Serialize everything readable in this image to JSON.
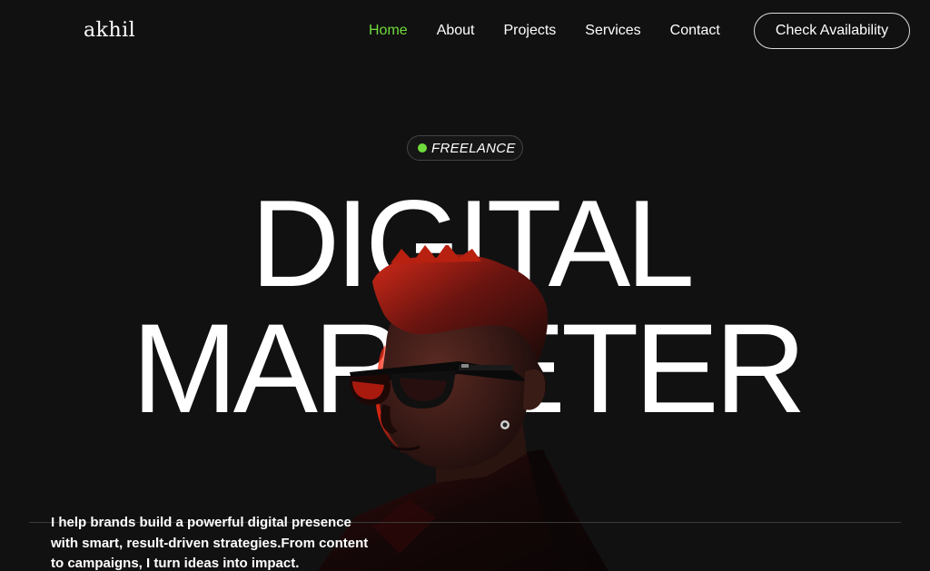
{
  "header": {
    "logo": "akhil",
    "nav": [
      {
        "label": "Home",
        "active": true
      },
      {
        "label": "About",
        "active": false
      },
      {
        "label": "Projects",
        "active": false
      },
      {
        "label": "Services",
        "active": false
      },
      {
        "label": "Contact",
        "active": false
      }
    ],
    "cta_label": "Check Availability"
  },
  "hero": {
    "badge": "FREELANCE",
    "headline_line1": "DIGITAL",
    "headline_line2": "MARKETER",
    "intro": "I help brands build a powerful digital presence with smart, result-driven strategies.From content to campaigns, I turn ideas into impact."
  },
  "colors": {
    "background": "#111111",
    "accent": "#6fdc3c",
    "text": "#ffffff"
  }
}
